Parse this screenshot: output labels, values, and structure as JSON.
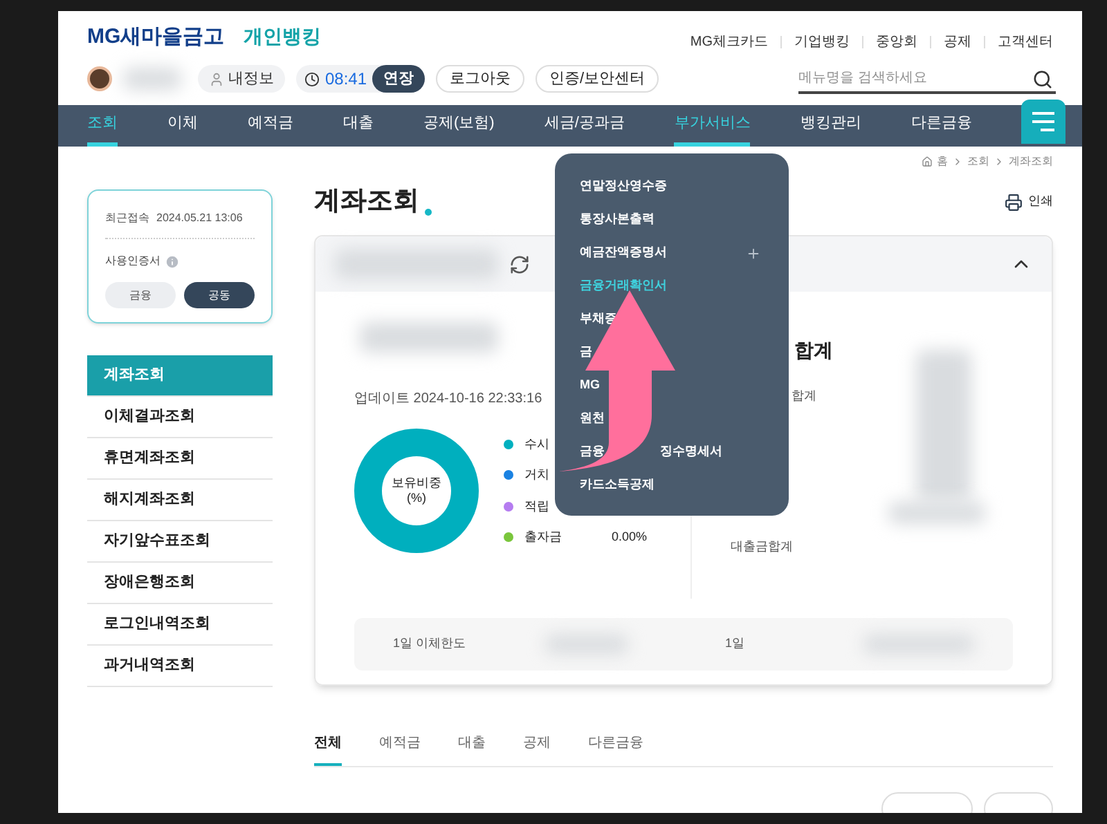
{
  "header": {
    "logo": "MG새마을금고",
    "section": "개인뱅킹",
    "top_links": [
      "MG체크카드",
      "기업뱅킹",
      "중앙회",
      "공제",
      "고객센터"
    ],
    "my_info": "내정보",
    "timer": "08:41",
    "extend": "연장",
    "logout": "로그아웃",
    "security": "인증/보안센터",
    "search": {
      "placeholder": "메뉴명을 검색하세요"
    }
  },
  "nav": [
    {
      "label": "조회",
      "selected": true
    },
    {
      "label": "이체",
      "selected": false
    },
    {
      "label": "예적금",
      "selected": false
    },
    {
      "label": "대출",
      "selected": false
    },
    {
      "label": "공제(보험)",
      "selected": false
    },
    {
      "label": "세금/공과금",
      "selected": false
    },
    {
      "label": "부가서비스",
      "selected": true
    },
    {
      "label": "뱅킹관리",
      "selected": false
    },
    {
      "label": "다른금융",
      "selected": false
    }
  ],
  "breadcrumb": [
    "홈",
    "조회",
    "계좌조회"
  ],
  "login_card": {
    "last_access_label": "최근접속",
    "last_access": "2024.05.21 13:06",
    "cert_label": "사용인증서",
    "cert_options": [
      {
        "label": "금융",
        "selected": false
      },
      {
        "label": "공동",
        "selected": true
      }
    ]
  },
  "sidebar": [
    {
      "label": "계좌조회",
      "selected": true
    },
    {
      "label": "이체결과조회",
      "selected": false
    },
    {
      "label": "휴면계좌조회",
      "selected": false
    },
    {
      "label": "해지계좌조회",
      "selected": false
    },
    {
      "label": "자기앞수표조회",
      "selected": false
    },
    {
      "label": "장애은행조회",
      "selected": false
    },
    {
      "label": "로그인내역조회",
      "selected": false
    },
    {
      "label": "과거내역조회",
      "selected": false
    }
  ],
  "page_title": "계좌조회",
  "print": "인쇄",
  "summary": {
    "updated": "업데이트 2024-10-16 22:33:16",
    "donut_label": "보유비중",
    "donut_unit": "(%)",
    "legend": [
      {
        "label": "수시",
        "color": "#00b0bf"
      },
      {
        "label": "거치",
        "color": "#1a82e2"
      },
      {
        "label": "적립",
        "color": "#b57cf0"
      },
      {
        "label": "출자금",
        "color": "#7ac63c",
        "value": "0.00%"
      }
    ],
    "total_heading": "합계",
    "total_label": "합계",
    "loan_total": "대출금합계",
    "limit_label": "1일 이체한도",
    "limit_label_2": "1일"
  },
  "dropdown": [
    {
      "label": "연말정산영수증",
      "selected": false,
      "expandable": false
    },
    {
      "label": "통장사본출력",
      "selected": false,
      "expandable": false
    },
    {
      "label": "예금잔액증명서",
      "selected": false,
      "expandable": true
    },
    {
      "label": "금융거래확인서",
      "selected": true,
      "expandable": false
    },
    {
      "label": "부채증",
      "selected": false,
      "expandable": false
    },
    {
      "label": "금",
      "selected": false,
      "expandable": false
    },
    {
      "label": "MG",
      "selected": false,
      "expandable": false
    },
    {
      "label": "원천",
      "selected": false,
      "expandable": false
    },
    {
      "label": "금융",
      "tail": "징수명세서",
      "selected": false,
      "expandable": false
    },
    {
      "label": "카드소득공제",
      "selected": false,
      "expandable": false
    }
  ],
  "tabs": [
    {
      "label": "전체",
      "selected": true
    },
    {
      "label": "예적금",
      "selected": false
    },
    {
      "label": "대출",
      "selected": false
    },
    {
      "label": "공제",
      "selected": false
    },
    {
      "label": "다른금융",
      "selected": false
    }
  ]
}
